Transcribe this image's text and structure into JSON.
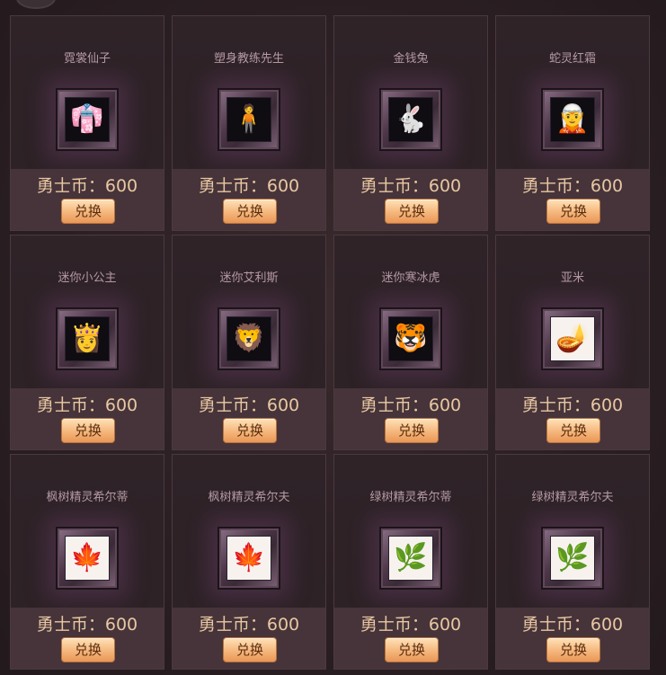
{
  "items": [
    {
      "name": "霓裳仙子",
      "price": "勇士币：600",
      "button": "兑换",
      "icon": "red-dress-girl-icon",
      "glyph": "👘",
      "light": false
    },
    {
      "name": "塑身教练先生",
      "price": "勇士币：600",
      "button": "兑换",
      "icon": "fitness-coach-icon",
      "glyph": "🧍",
      "light": false
    },
    {
      "name": "金钱兔",
      "price": "勇士币：600",
      "button": "兑换",
      "icon": "money-rabbit-icon",
      "glyph": "🐇",
      "light": false
    },
    {
      "name": "蛇灵红霜",
      "price": "勇士币：600",
      "button": "兑换",
      "icon": "snake-spirit-girl-icon",
      "glyph": "🧝",
      "light": false
    },
    {
      "name": "迷你小公主",
      "price": "勇士币：600",
      "button": "兑换",
      "icon": "mini-princess-icon",
      "glyph": "👸",
      "light": false
    },
    {
      "name": "迷你艾利斯",
      "price": "勇士币：600",
      "button": "兑换",
      "icon": "mini-ellis-icon",
      "glyph": "🦁",
      "light": false
    },
    {
      "name": "迷你寒冰虎",
      "price": "勇士币：600",
      "button": "兑换",
      "icon": "mini-ice-tiger-icon",
      "glyph": "🐯",
      "light": false
    },
    {
      "name": "亚米",
      "price": "勇士币：600",
      "button": "兑换",
      "icon": "yami-lamp-icon",
      "glyph": "🪔",
      "light": true
    },
    {
      "name": "枫树精灵希尔蒂",
      "price": "勇士币：600",
      "button": "兑换",
      "icon": "maple-spirit-hilde-icon",
      "glyph": "🍁",
      "light": true
    },
    {
      "name": "枫树精灵希尔夫",
      "price": "勇士币：600",
      "button": "兑换",
      "icon": "maple-spirit-hilf-icon",
      "glyph": "🍁",
      "light": true
    },
    {
      "name": "绿树精灵希尔蒂",
      "price": "勇士币：600",
      "button": "兑换",
      "icon": "green-spirit-hilde-icon",
      "glyph": "🌿",
      "light": true
    },
    {
      "name": "绿树精灵希尔夫",
      "price": "勇士币：600",
      "button": "兑换",
      "icon": "green-spirit-hilf-icon",
      "glyph": "🌿",
      "light": true
    }
  ]
}
